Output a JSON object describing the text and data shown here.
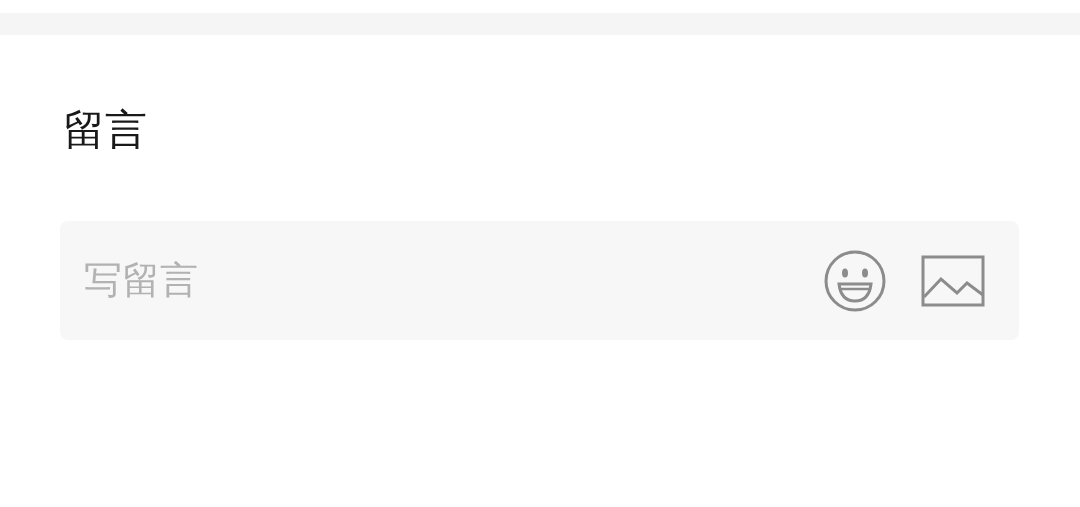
{
  "section": {
    "title": "留言"
  },
  "comment": {
    "placeholder": "写留言"
  }
}
